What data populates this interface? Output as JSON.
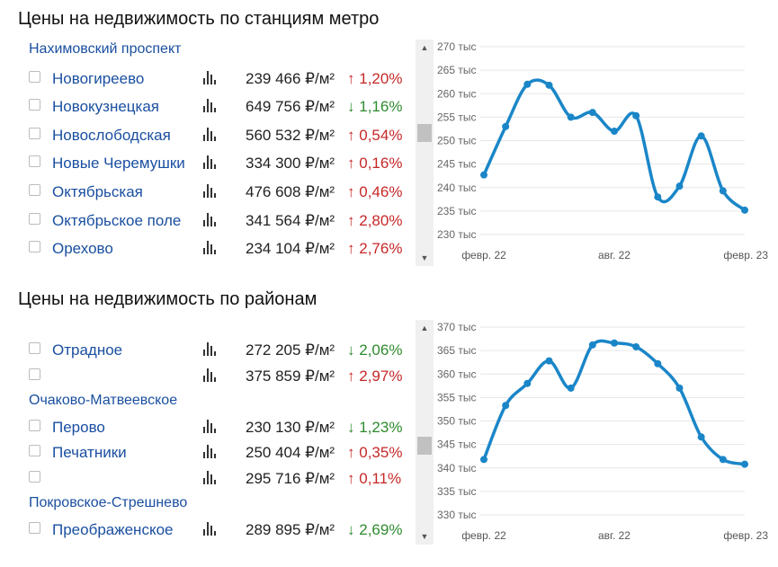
{
  "metro": {
    "title": "Цены на недвижимость по станциям метро",
    "rows": [
      {
        "type": "group",
        "label": "Нахимовский проспект"
      },
      {
        "type": "item",
        "name": "Новогиреево",
        "price": "239 466 ₽/м²",
        "arrow": "↑",
        "change": "1,20%",
        "dir": "up"
      },
      {
        "type": "item",
        "name": "Новокузнецкая",
        "price": "649 756 ₽/м²",
        "arrow": "↓",
        "change": "1,16%",
        "dir": "down"
      },
      {
        "type": "item",
        "name": "Новослободская",
        "price": "560 532 ₽/м²",
        "arrow": "↑",
        "change": "0,54%",
        "dir": "up"
      },
      {
        "type": "item",
        "name": "Новые Черемушки",
        "price": "334 300 ₽/м²",
        "arrow": "↑",
        "change": "0,16%",
        "dir": "up"
      },
      {
        "type": "item",
        "name": "Октябрьская",
        "price": "476 608 ₽/м²",
        "arrow": "↑",
        "change": "0,46%",
        "dir": "up"
      },
      {
        "type": "item",
        "name": "Октябрьское поле",
        "price": "341 564 ₽/м²",
        "arrow": "↑",
        "change": "2,80%",
        "dir": "up"
      },
      {
        "type": "item",
        "name": "Орехово",
        "price": "234 104 ₽/м²",
        "arrow": "↑",
        "change": "2,76%",
        "dir": "up"
      }
    ]
  },
  "districts": {
    "title": "Цены на недвижимость по районам",
    "rows": [
      {
        "type": "item",
        "name": "Отрадное",
        "price": "272 205 ₽/м²",
        "arrow": "↓",
        "change": "2,06%",
        "dir": "down"
      },
      {
        "type": "item",
        "name": "",
        "price": "375 859 ₽/м²",
        "arrow": "↑",
        "change": "2,97%",
        "dir": "up"
      },
      {
        "type": "group",
        "label": "Очаково-Матвеевское"
      },
      {
        "type": "item",
        "name": "Перово",
        "price": "230 130 ₽/м²",
        "arrow": "↓",
        "change": "1,23%",
        "dir": "down"
      },
      {
        "type": "item",
        "name": "Печатники",
        "price": "250 404 ₽/м²",
        "arrow": "↑",
        "change": "0,35%",
        "dir": "up"
      },
      {
        "type": "item",
        "name": "",
        "price": "295 716 ₽/м²",
        "arrow": "↑",
        "change": "0,11%",
        "dir": "up"
      },
      {
        "type": "group",
        "label": "Покровское-Стрешнево"
      },
      {
        "type": "item",
        "name": "Преображенское",
        "price": "289 895 ₽/м²",
        "arrow": "↓",
        "change": "2,69%",
        "dir": "down"
      }
    ]
  },
  "colors": {
    "line": "#1a86c8",
    "link": "#1a4fa0",
    "up": "#c62828",
    "down": "#2e8b2e",
    "grid": "#e6e6e6"
  },
  "icons": {
    "bar_chart": "bar-chart-icon",
    "scroll_up": "scroll-up-arrow",
    "scroll_down": "scroll-down-arrow"
  },
  "chart_data": [
    {
      "type": "line",
      "title": "",
      "xlabel": "",
      "ylabel": "",
      "x_ticks": [
        "февр. 22",
        "авг. 22",
        "февр. 23"
      ],
      "y_ticks": [
        "230 тыс",
        "235 тыс",
        "240 тыс",
        "245 тыс",
        "250 тыс",
        "255 тыс",
        "260 тыс",
        "265 тыс",
        "270 тыс"
      ],
      "ylim": [
        230000,
        270000
      ],
      "x": [
        0,
        1,
        2,
        3,
        4,
        5,
        6,
        7,
        8,
        9,
        10,
        11,
        12
      ],
      "values": [
        242700,
        253000,
        262000,
        261800,
        255000,
        256000,
        252000,
        255300,
        238000,
        240300,
        251000,
        239300,
        235200
      ],
      "grid": true
    },
    {
      "type": "line",
      "title": "",
      "xlabel": "",
      "ylabel": "",
      "x_ticks": [
        "февр. 22",
        "авг. 22",
        "февр. 23"
      ],
      "y_ticks": [
        "330 тыс",
        "335 тыс",
        "340 тыс",
        "345 тыс",
        "350 тыс",
        "355 тыс",
        "360 тыс",
        "365 тыс",
        "370 тыс"
      ],
      "ylim": [
        330000,
        370000
      ],
      "x": [
        0,
        1,
        2,
        3,
        4,
        5,
        6,
        7,
        8,
        9,
        10,
        11,
        12
      ],
      "values": [
        341800,
        353300,
        358000,
        362800,
        357000,
        366200,
        366600,
        365800,
        362200,
        357000,
        346600,
        341800,
        340800
      ],
      "grid": true
    }
  ]
}
